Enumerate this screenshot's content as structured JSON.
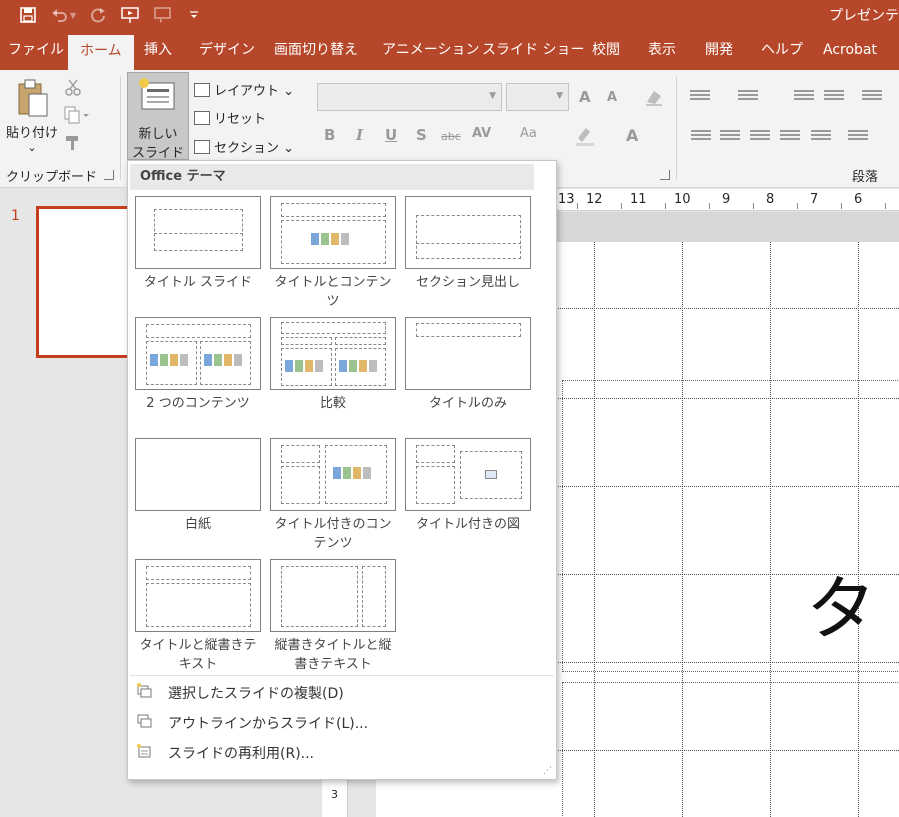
{
  "window": {
    "title": "プレゼンテ"
  },
  "qat": {
    "save_icon": "save-icon",
    "undo_icon": "undo-icon",
    "redo_icon": "redo-icon",
    "present_icon": "present-from-start-icon",
    "touch_icon": "touch-mode-icon",
    "customize_icon": "customize-qat-icon"
  },
  "tabs": [
    {
      "label": "ファイル"
    },
    {
      "label": "ホーム",
      "active": true
    },
    {
      "label": "挿入"
    },
    {
      "label": "デザイン"
    },
    {
      "label": "画面切り替え"
    },
    {
      "label": "アニメーション"
    },
    {
      "label": "スライド ショー"
    },
    {
      "label": "校閲"
    },
    {
      "label": "表示"
    },
    {
      "label": "開発"
    },
    {
      "label": "ヘルプ"
    },
    {
      "label": "Acrobat"
    }
  ],
  "ribbon": {
    "clipboard": {
      "paste_label": "貼り付け",
      "paste_caret": "⌄",
      "group_label": "クリップボード"
    },
    "slides": {
      "new_slide_line1": "新しい",
      "new_slide_line2": "スライド ⌄",
      "layout_label": "レイアウト ⌄",
      "reset_label": "リセット",
      "section_label": "セクション ⌄"
    },
    "font": {
      "grow": "A",
      "shrink": "A",
      "bold": "B",
      "italic": "I",
      "underline": "U",
      "shadow": "S",
      "strike": "abc",
      "spacing": "AV",
      "case": "Aa",
      "color": "A"
    },
    "paragraph": {
      "group_label": "段落"
    }
  },
  "ruler": {
    "numbers": [
      "13",
      "12",
      "11",
      "10",
      "9",
      "8",
      "7",
      "6"
    ]
  },
  "slide_panel": {
    "slide_number": "1"
  },
  "canvas": {
    "visible_text": "タ"
  },
  "vruler": {
    "number": "3"
  },
  "gallery": {
    "header": "Office テーマ",
    "layouts": [
      {
        "label": "タイトル スライド"
      },
      {
        "label": "タイトルとコンテンツ"
      },
      {
        "label": "セクション見出し"
      },
      {
        "label": "2 つのコンテンツ"
      },
      {
        "label": "比較"
      },
      {
        "label": "タイトルのみ"
      },
      {
        "label": "白紙"
      },
      {
        "label": "タイトル付きのコンテンツ"
      },
      {
        "label": "タイトル付きの図"
      },
      {
        "label": "タイトルと縦書きテキスト"
      },
      {
        "label": "縦書きタイトルと縦書きテキスト"
      }
    ],
    "menu": [
      {
        "label": "選択したスライドの複製(D)"
      },
      {
        "label": "アウトラインからスライド(L)..."
      },
      {
        "label": "スライドの再利用(R)..."
      }
    ]
  }
}
